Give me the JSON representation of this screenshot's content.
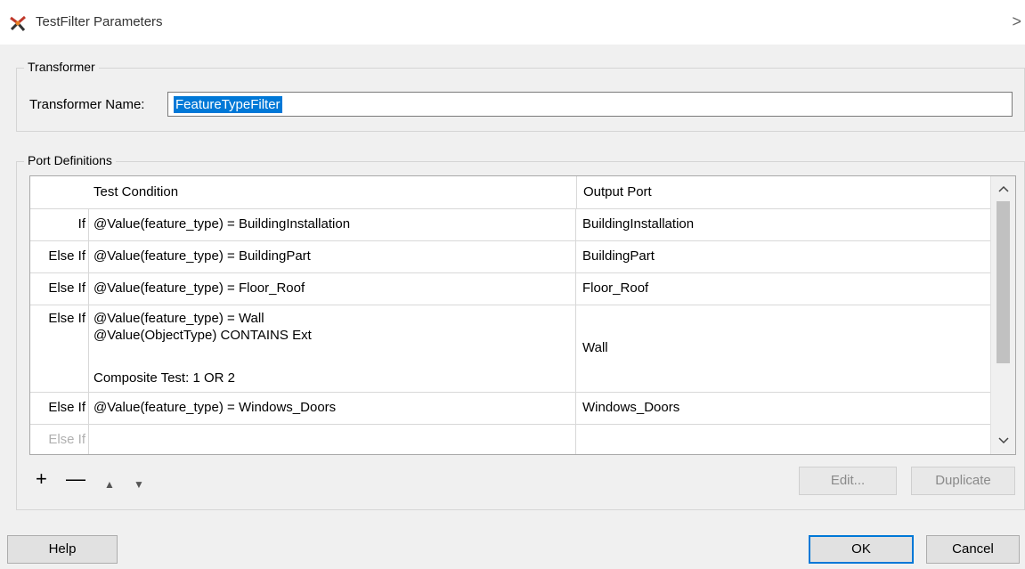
{
  "window": {
    "title": "TestFilter Parameters",
    "close_glyph": ">"
  },
  "transformer": {
    "group_label": "Transformer",
    "name_label": "Transformer Name:",
    "name_value": "FeatureTypeFilter"
  },
  "ports": {
    "group_label": "Port Definitions",
    "headers": {
      "condition": "Test Condition",
      "output": "Output Port"
    },
    "rows": [
      {
        "keyword": "If",
        "condition": "@Value(feature_type) = BuildingInstallation",
        "output": "BuildingInstallation"
      },
      {
        "keyword": "Else If",
        "condition": "@Value(feature_type) = BuildingPart",
        "output": "BuildingPart"
      },
      {
        "keyword": "Else If",
        "condition": "@Value(feature_type) = Floor_Roof",
        "output": "Floor_Roof"
      },
      {
        "keyword": "Else If",
        "condition_lines": [
          "@Value(feature_type) = Wall",
          "@Value(ObjectType) CONTAINS Ext",
          "Composite Test: 1 OR 2"
        ],
        "output": "Wall"
      },
      {
        "keyword": "Else If",
        "condition": "@Value(feature_type) = Windows_Doors",
        "output": "Windows_Doors"
      },
      {
        "keyword": "Else If",
        "condition": "",
        "output": ""
      }
    ]
  },
  "toolbar": {
    "add": "+",
    "remove": "—",
    "up": "▲",
    "down": "▼"
  },
  "buttons": {
    "edit": "Edit...",
    "duplicate": "Duplicate",
    "help": "Help",
    "ok": "OK",
    "cancel": "Cancel"
  },
  "icons": {
    "app": "fme-transformer-icon",
    "scroll_up": "chevron-up-icon",
    "scroll_down": "chevron-down-icon"
  }
}
